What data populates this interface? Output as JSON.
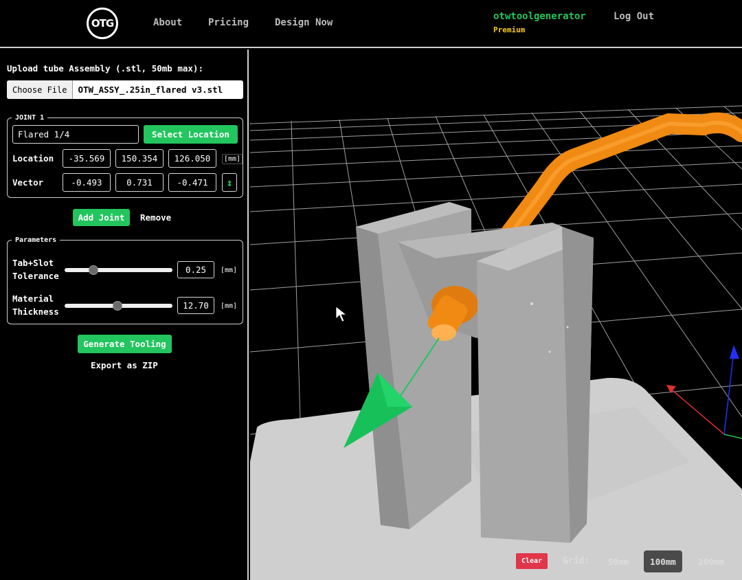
{
  "nav": {
    "logo_text": "OTG",
    "links": [
      "About",
      "Pricing",
      "Design Now"
    ],
    "username": "otwtoolgenerator",
    "tier": "Premium",
    "logout": "Log Out"
  },
  "upload": {
    "label": "Upload tube Assembly (.stl, 50mb max):",
    "button": "Choose File",
    "filename": "OTW_ASSY_.25in_flared v3.stl"
  },
  "joint": {
    "legend": "JOINT 1",
    "type": "Flared 1/4",
    "select_button": "Select Location",
    "location_label": "Location",
    "location": [
      "-35.569",
      "150.354",
      "126.050"
    ],
    "unit": "[mm]",
    "vector_label": "Vector",
    "vector": [
      "-0.493",
      "0.731",
      "-0.471"
    ],
    "flip_glyph": "↕"
  },
  "joint_actions": {
    "add": "Add Joint",
    "remove": "Remove"
  },
  "params": {
    "legend": "Parameters",
    "tolerance_label_1": "Tab+Slot",
    "tolerance_label_2": "Tolerance",
    "tolerance_value": "0.25",
    "tolerance_fraction": 0.27,
    "thickness_label_1": "Material",
    "thickness_label_2": "Thickness",
    "thickness_value": "12.70",
    "thickness_fraction": 0.49,
    "unit": "[mm]"
  },
  "actions": {
    "generate": "Generate Tooling",
    "export": "Export as ZIP"
  },
  "viewport": {
    "clear": "Clear",
    "grid_label": "Grid:",
    "grid_options": [
      "50mm",
      "100mm",
      "200mm"
    ],
    "grid_selected": "100mm"
  },
  "colors": {
    "accent": "#22c55e",
    "premium": "#facc15",
    "clear": "#e0354a",
    "tube": "#f08a12",
    "part": "#a9a9a9"
  },
  "icons": {
    "logo": "otg-logo-icon",
    "flip": "flip-vector-icon",
    "cursor": "mouse-cursor-icon"
  }
}
